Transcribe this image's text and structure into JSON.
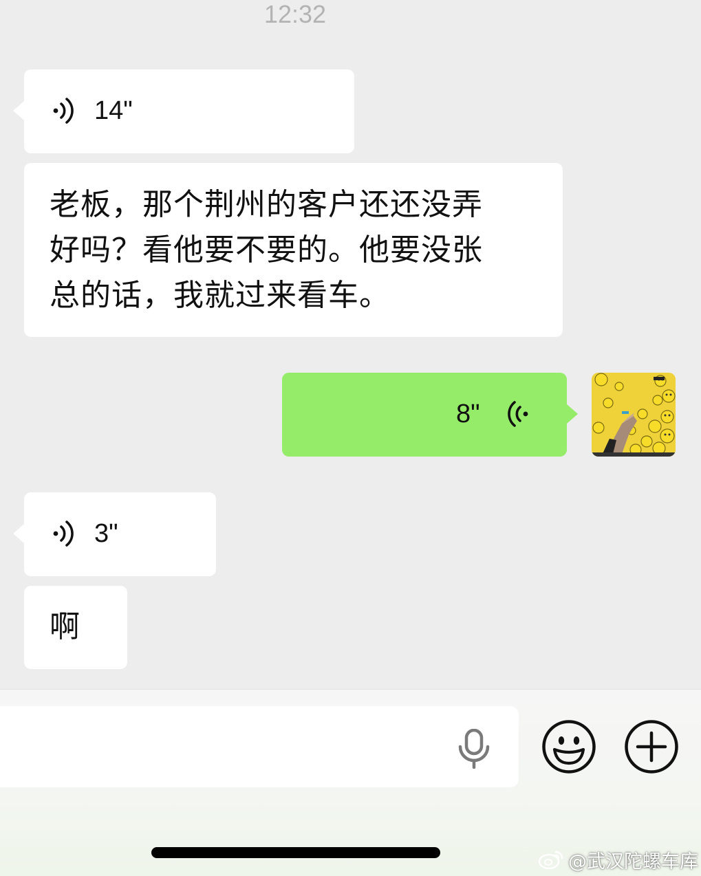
{
  "chat": {
    "timestamp": "12:32",
    "messages": [
      {
        "type": "voice",
        "direction": "in",
        "duration": "14\""
      },
      {
        "type": "text",
        "direction": "in",
        "lines": [
          "老板，那个荆州的客户还还没弄",
          "好吗？看他要不要的。他要没张",
          "总的话，我就过来看车。"
        ]
      },
      {
        "type": "voice",
        "direction": "out",
        "duration": "8\"",
        "avatar": "emoji-sticker-avatar"
      },
      {
        "type": "voice",
        "direction": "in",
        "duration": "3\""
      },
      {
        "type": "text",
        "direction": "in",
        "lines": [
          "啊"
        ]
      }
    ]
  },
  "input_bar": {
    "value": "",
    "icons": [
      "microphone-icon",
      "emoji-icon",
      "plus-icon"
    ]
  },
  "watermark": {
    "text": "@武汉陀螺车库",
    "icon": "weibo-icon"
  },
  "colors": {
    "background": "#ededed",
    "incoming_bubble": "#ffffff",
    "outgoing_bubble": "#95ec69",
    "outgoing_voice_icon": "#1a1a1a"
  }
}
